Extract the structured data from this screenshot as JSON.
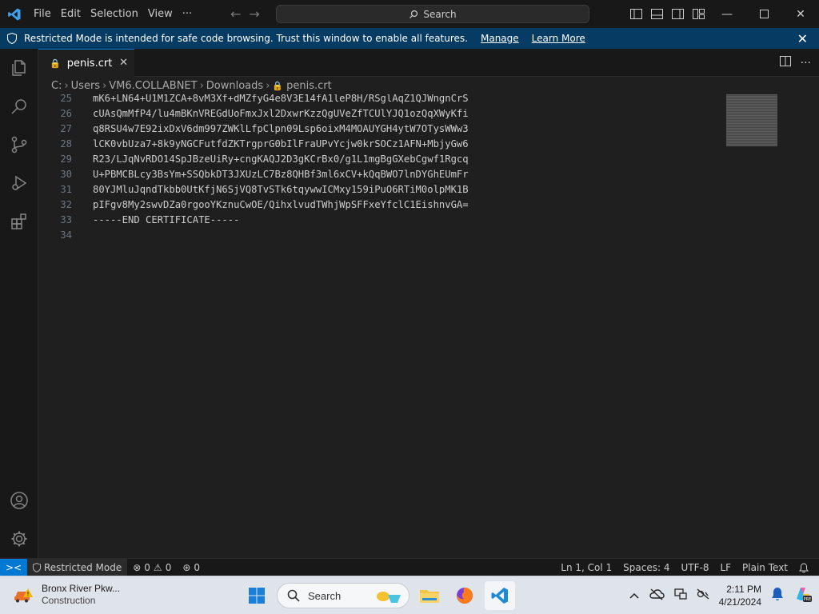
{
  "titlebar": {
    "menu": [
      "File",
      "Edit",
      "Selection",
      "View",
      "···"
    ],
    "command_center": "Search"
  },
  "banner": {
    "message": "Restricted Mode is intended for safe code browsing. Trust this window to enable all features.",
    "manage": "Manage",
    "learn_more": "Learn More"
  },
  "tab": {
    "label": "penis.crt"
  },
  "breadcrumb": [
    "C:",
    "Users",
    "VM6.COLLABNET",
    "Downloads",
    "penis.crt"
  ],
  "editor": {
    "lines": [
      {
        "n": "25",
        "text": "mK6+LN64+U1M1ZCA+8vM3Xf+dMZfyG4e8V3E14fA1leP8H/RSglAqZ1QJWngnCrS"
      },
      {
        "n": "26",
        "text": "cUAsQmMfP4/lu4mBKnVREGdUoFmxJxl2DxwrKzzQgUVeZfTCUlYJQ1ozQqXWyKfi"
      },
      {
        "n": "27",
        "text": "q8RSU4w7E92ixDxV6dm997ZWKlLfpClpn09Lsp6oixM4MOAUYGH4ytW7OTysWWw3"
      },
      {
        "n": "28",
        "text": "lCK0vbUza7+8k9yNGCFutfdZKTrgprG0bIlFraUPvYcjw0krSOCz1AFN+MbjyGw6"
      },
      {
        "n": "29",
        "text": "R23/LJqNvRDO14SpJBzeUiRy+cngKAQJ2D3gKCrBx0/g1L1mgBgGXebCgwf1Rgcq"
      },
      {
        "n": "30",
        "text": "U+PBMCBLcy3BsYm+SSQbkDT3JXUzLC7Bz8QHBf3ml6xCV+kQqBWO7lnDYGhEUmFr"
      },
      {
        "n": "31",
        "text": "80YJMluJqndTkbb0UtKfjN6SjVQ8TvSTk6tqywwICMxy159iPuO6RTiM0olpMK1B"
      },
      {
        "n": "32",
        "text": "pIFgv8My2swvDZa0rgooYKznuCwOE/QihxlvudTWhjWpSFFxeYfclC1EishnvGA="
      },
      {
        "n": "33",
        "text": "-----END CERTIFICATE-----"
      },
      {
        "n": "34",
        "text": ""
      }
    ]
  },
  "statusbar": {
    "restricted": "Restricted Mode",
    "errors": "0",
    "warnings": "0",
    "ports": "0",
    "position": "Ln 1, Col 1",
    "spaces": "Spaces: 4",
    "encoding": "UTF-8",
    "eol": "LF",
    "language": "Plain Text"
  },
  "taskbar": {
    "weather_title": "Bronx River Pkw...",
    "weather_sub": "Construction",
    "search": "Search",
    "time": "2:11 PM",
    "date": "4/21/2024"
  },
  "colors": {
    "accent": "#0078d4",
    "banner": "#063b63",
    "editor_bg": "#1f1f1f"
  }
}
